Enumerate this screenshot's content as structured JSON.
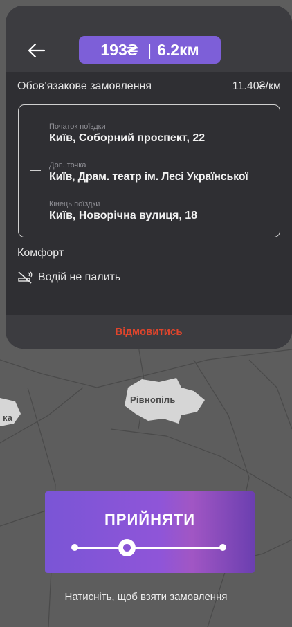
{
  "header": {
    "price": "193₴",
    "distance": "6.2км",
    "back_icon": "arrow-left-icon"
  },
  "order": {
    "type_label": "Обов’язакове замовлення",
    "rate": "11.40₴/км"
  },
  "route": {
    "stops": [
      {
        "caption": "Початок поїздки",
        "address": "Київ, Соборний проспект, 22"
      },
      {
        "caption": "Доп. точка",
        "address": "Київ, Драм. театр  ім. Лесі Української"
      },
      {
        "caption": "Кінець поїздки",
        "address": "Київ, Новорічна вулиця, 18"
      }
    ]
  },
  "comfort": {
    "title": "Комфорт",
    "items": [
      {
        "icon": "no-smoking-icon",
        "label": "Водій не палить"
      }
    ]
  },
  "cancel_label": "Відмовитись",
  "map": {
    "labels": [
      "Рівнопіль",
      "ка"
    ]
  },
  "accept": {
    "label": "ПРИЙНЯТИ",
    "hint": "Натисніть, щоб взяти замовлення"
  },
  "colors": {
    "accent": "#7d5fd8",
    "cancel": "#e0452c",
    "card": "#2f2f33",
    "card_header": "#3c3c40"
  }
}
